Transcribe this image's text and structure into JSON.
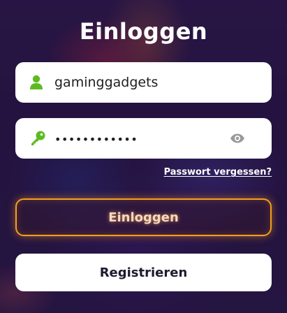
{
  "login": {
    "title": "Einloggen",
    "username": {
      "value": "gaminggadgets",
      "icon": "user-icon"
    },
    "password": {
      "value": "••••••••••••",
      "icon": "key-icon",
      "toggle_icon": "eye-icon"
    },
    "forgot_password_label": "Passwort vergessen?",
    "login_button_label": "Einloggen",
    "register_button_label": "Registrieren"
  },
  "colors": {
    "icon_green": "#5dbb1f",
    "login_border": "#f2a11e",
    "background": "#2b1848"
  }
}
